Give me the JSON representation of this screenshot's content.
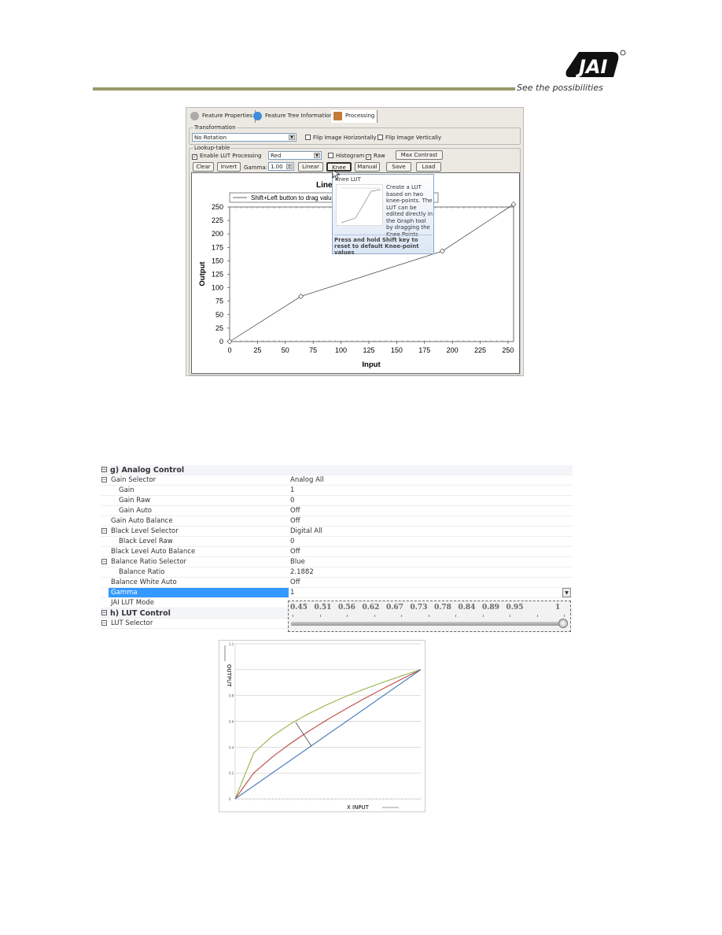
{
  "header": {
    "logo_text": "JAI",
    "tagline": "See the possibilities",
    "rule_color": "#9a9a6a"
  },
  "processing_panel": {
    "tabs": [
      {
        "label": "Feature Properties"
      },
      {
        "label": "Feature Tree Information"
      },
      {
        "label": "Processing"
      }
    ],
    "transformation": {
      "legend": "Transformation",
      "rotation": "No Rotation",
      "flip_h": "Flip Image Horizontally",
      "flip_h_checked": false,
      "flip_v": "Flip Image Vertically",
      "flip_v_checked": false
    },
    "lookup": {
      "legend": "Lookup-table",
      "enable_lut": "Enable LUT Processing",
      "enable_lut_checked": true,
      "channel": "Red",
      "histogram": "Histogram",
      "histogram_checked": false,
      "raw": "Raw",
      "raw_checked": true,
      "buttons": {
        "max_contrast": "Max Contrast",
        "clear": "Clear",
        "invert": "Invert",
        "linear": "Linear",
        "knee": "Knee",
        "manual": "Manual",
        "save": "Save",
        "load": "Load"
      },
      "gamma_label": "Gamma:",
      "gamma_value": "1.00"
    },
    "tooltip": {
      "title": "Knee LUT",
      "body": "Create a LUT based on two knee-points. The LUT can be edited directly in the Graph tool by dragging the Knee Points",
      "footer": "Press and hold Shift key to reset to default Knee-point values"
    }
  },
  "property_grid": {
    "rows": [
      {
        "name": "g) Analog Control",
        "value": "",
        "category": true,
        "expander": "⊟",
        "indent": 0
      },
      {
        "name": "Gain Selector",
        "value": "Analog All",
        "expander": "⊟",
        "indent": 1
      },
      {
        "name": "Gain",
        "value": "1",
        "indent": 2
      },
      {
        "name": "Gain Raw",
        "value": "0",
        "indent": 2
      },
      {
        "name": "Gain Auto",
        "value": "Off",
        "indent": 2
      },
      {
        "name": "Gain Auto Balance",
        "value": "Off",
        "indent": 1
      },
      {
        "name": "Black Level Selector",
        "value": "Digital All",
        "expander": "⊟",
        "indent": 1
      },
      {
        "name": "Black Level Raw",
        "value": "0",
        "indent": 2
      },
      {
        "name": "Black Level Auto Balance",
        "value": "Off",
        "indent": 1
      },
      {
        "name": "Balance Ratio Selector",
        "value": "Blue",
        "expander": "⊟",
        "indent": 1
      },
      {
        "name": "Balance Ratio",
        "value": "2.1882",
        "indent": 2
      },
      {
        "name": "Balance White Auto",
        "value": "Off",
        "indent": 1
      },
      {
        "name": "Gamma",
        "value": "1",
        "indent": 1,
        "selected": true
      },
      {
        "name": "JAI LUT Mode",
        "value": "",
        "indent": 1
      },
      {
        "name": "h) LUT Control",
        "value": "",
        "category": true,
        "expander": "⊟",
        "indent": 0
      },
      {
        "name": "LUT Selector",
        "value": "",
        "expander": "⊟",
        "indent": 1
      }
    ],
    "selection_color": "#3399ff",
    "gamma_slider": {
      "ticks": [
        "0.45",
        "0.51",
        "0.56",
        "0.62",
        "0.67",
        "0.73",
        "0.78",
        "0.84",
        "0.89",
        "0.95",
        "1"
      ],
      "value": 1
    }
  },
  "chart_data": [
    {
      "type": "line",
      "title": "Linear Kn",
      "legend": "Shift+Left button to drag valu",
      "xlabel": "Input",
      "ylabel": "Output",
      "x": [
        0,
        64,
        191,
        255
      ],
      "values": [
        0,
        84,
        168,
        255
      ],
      "xlim": [
        0,
        255
      ],
      "ylim": [
        0,
        255
      ],
      "xticks": [
        0,
        25,
        50,
        75,
        100,
        125,
        150,
        175,
        200,
        225,
        250
      ],
      "yticks": [
        0,
        25,
        50,
        75,
        100,
        125,
        150,
        175,
        200,
        225,
        250
      ],
      "grid": false,
      "legend_placement": "top-left",
      "marker": "diamond"
    },
    {
      "type": "line",
      "xlabel": "X  INPUT",
      "ylabel": "OUTPUT",
      "ylim": [
        0,
        1.2
      ],
      "xlim": [
        0,
        1
      ],
      "yticks": [
        "0",
        "0.2",
        "0.4",
        "0.6",
        "0.8",
        "1",
        "1.2"
      ],
      "grid": true,
      "x": [
        0,
        0.1,
        0.2,
        0.3,
        0.4,
        0.5,
        0.6,
        0.7,
        0.8,
        0.9,
        1
      ],
      "series": [
        {
          "color": "#9bbb59",
          "values": [
            0,
            0.355,
            0.485,
            0.582,
            0.662,
            0.732,
            0.795,
            0.852,
            0.904,
            0.954,
            1
          ]
        },
        {
          "color": "#c0504d",
          "values": [
            0,
            0.2,
            0.324,
            0.431,
            0.527,
            0.616,
            0.699,
            0.779,
            0.855,
            0.929,
            1
          ]
        },
        {
          "color": "#4f81bd",
          "values": [
            0,
            0.1,
            0.2,
            0.3,
            0.4,
            0.5,
            0.6,
            0.7,
            0.8,
            0.9,
            1
          ]
        }
      ]
    }
  ]
}
